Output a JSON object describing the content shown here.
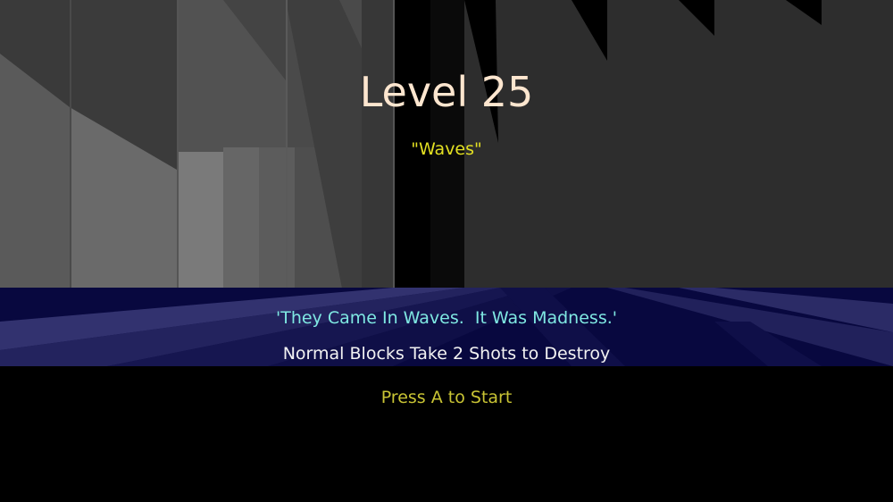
{
  "intro": {
    "level_title": "Level 25",
    "level_name": "\"Waves\"",
    "quote": "'They Came In Waves.  It Was Madness.'",
    "rule": "Normal Blocks Take 2 Shots to Destroy",
    "start_prompt": "Press A to Start"
  },
  "colors": {
    "title": "#fde6cf",
    "level_name": "#e3e022",
    "quote": "#7fe8e2",
    "rule": "#f2f2f2",
    "start_prompt": "#c9c434",
    "background": "#000000",
    "floor": "#08083f"
  }
}
